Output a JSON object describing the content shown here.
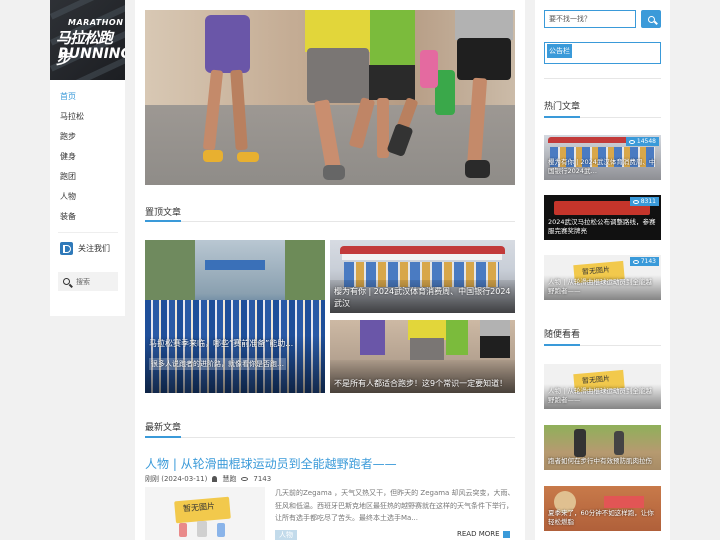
{
  "logo": {
    "line1": "MARATHON",
    "line2": "马拉松跑步",
    "line3": "RUNNING"
  },
  "nav": {
    "items": [
      {
        "label": "首页",
        "active": true
      },
      {
        "label": "马拉松"
      },
      {
        "label": "跑步"
      },
      {
        "label": "健身"
      },
      {
        "label": "跑团"
      },
      {
        "label": "人物"
      },
      {
        "label": "装备"
      }
    ],
    "follow_label": "关注我们",
    "search_label": "搜索"
  },
  "main": {
    "pinned_title": "置顶文章",
    "pinned": [
      {
        "caption": "马拉松赛季来临，哪些“赛前准备”能助…",
        "subcaption": "很多人说跑者的进阶路，就像看你是否跑…"
      },
      {
        "caption": "樱为有你 | 2024武汉体育消费周、中国银行2024武汉"
      },
      {
        "caption": "不是所有人都适合跑步！这9个常识一定要知道！"
      }
    ],
    "latest_title": "最新文章",
    "post": {
      "title": "人物 | 从轮滑曲棍球运动员到全能越野跑者——",
      "date": "刚刚 (2024-03-11)",
      "author": "慧跑",
      "views": "7143",
      "thumb_label": "暂无图片",
      "excerpt": "几天前的Zegama ，天气又热又干，但昨天的 Zegama 却风云突变，大雨、狂风和低温。西班牙巴斯克地区最狂热的越野赛就在这样的天气条件下举行，让所有选手都吃尽了苦头。最终本土选手Ma...",
      "tag": "人物",
      "read_more": "READ MORE"
    }
  },
  "sidebar": {
    "search_placeholder": "要不找一找？",
    "notice_label": "公告栏",
    "hot_title": "热门文章",
    "hot": [
      {
        "caption": "樱为有你 | 2024武汉体育消费周、中国银行2024武…",
        "views": "14548"
      },
      {
        "caption": "2024武汉马拉松公布调整路线，参赛服完赛奖牌亮",
        "views": "8311"
      },
      {
        "caption": "人物 | 从轮滑曲棍球运动员到全能越野跑者——",
        "views": "7143",
        "thumb_label": "暂无图片"
      }
    ],
    "random_title": "随便看看",
    "random": [
      {
        "caption": "人物 | 从轮滑曲棍球运动员到全能越野跑者——",
        "thumb_label": "暂无图片"
      },
      {
        "caption": "跑者如何在步行中有效预防肌肉拉伤"
      },
      {
        "caption": "夏季来了，60分钟不如这样跑，让你轻松燃脂"
      }
    ]
  },
  "colors": {
    "accent": "#3a9ad9"
  }
}
